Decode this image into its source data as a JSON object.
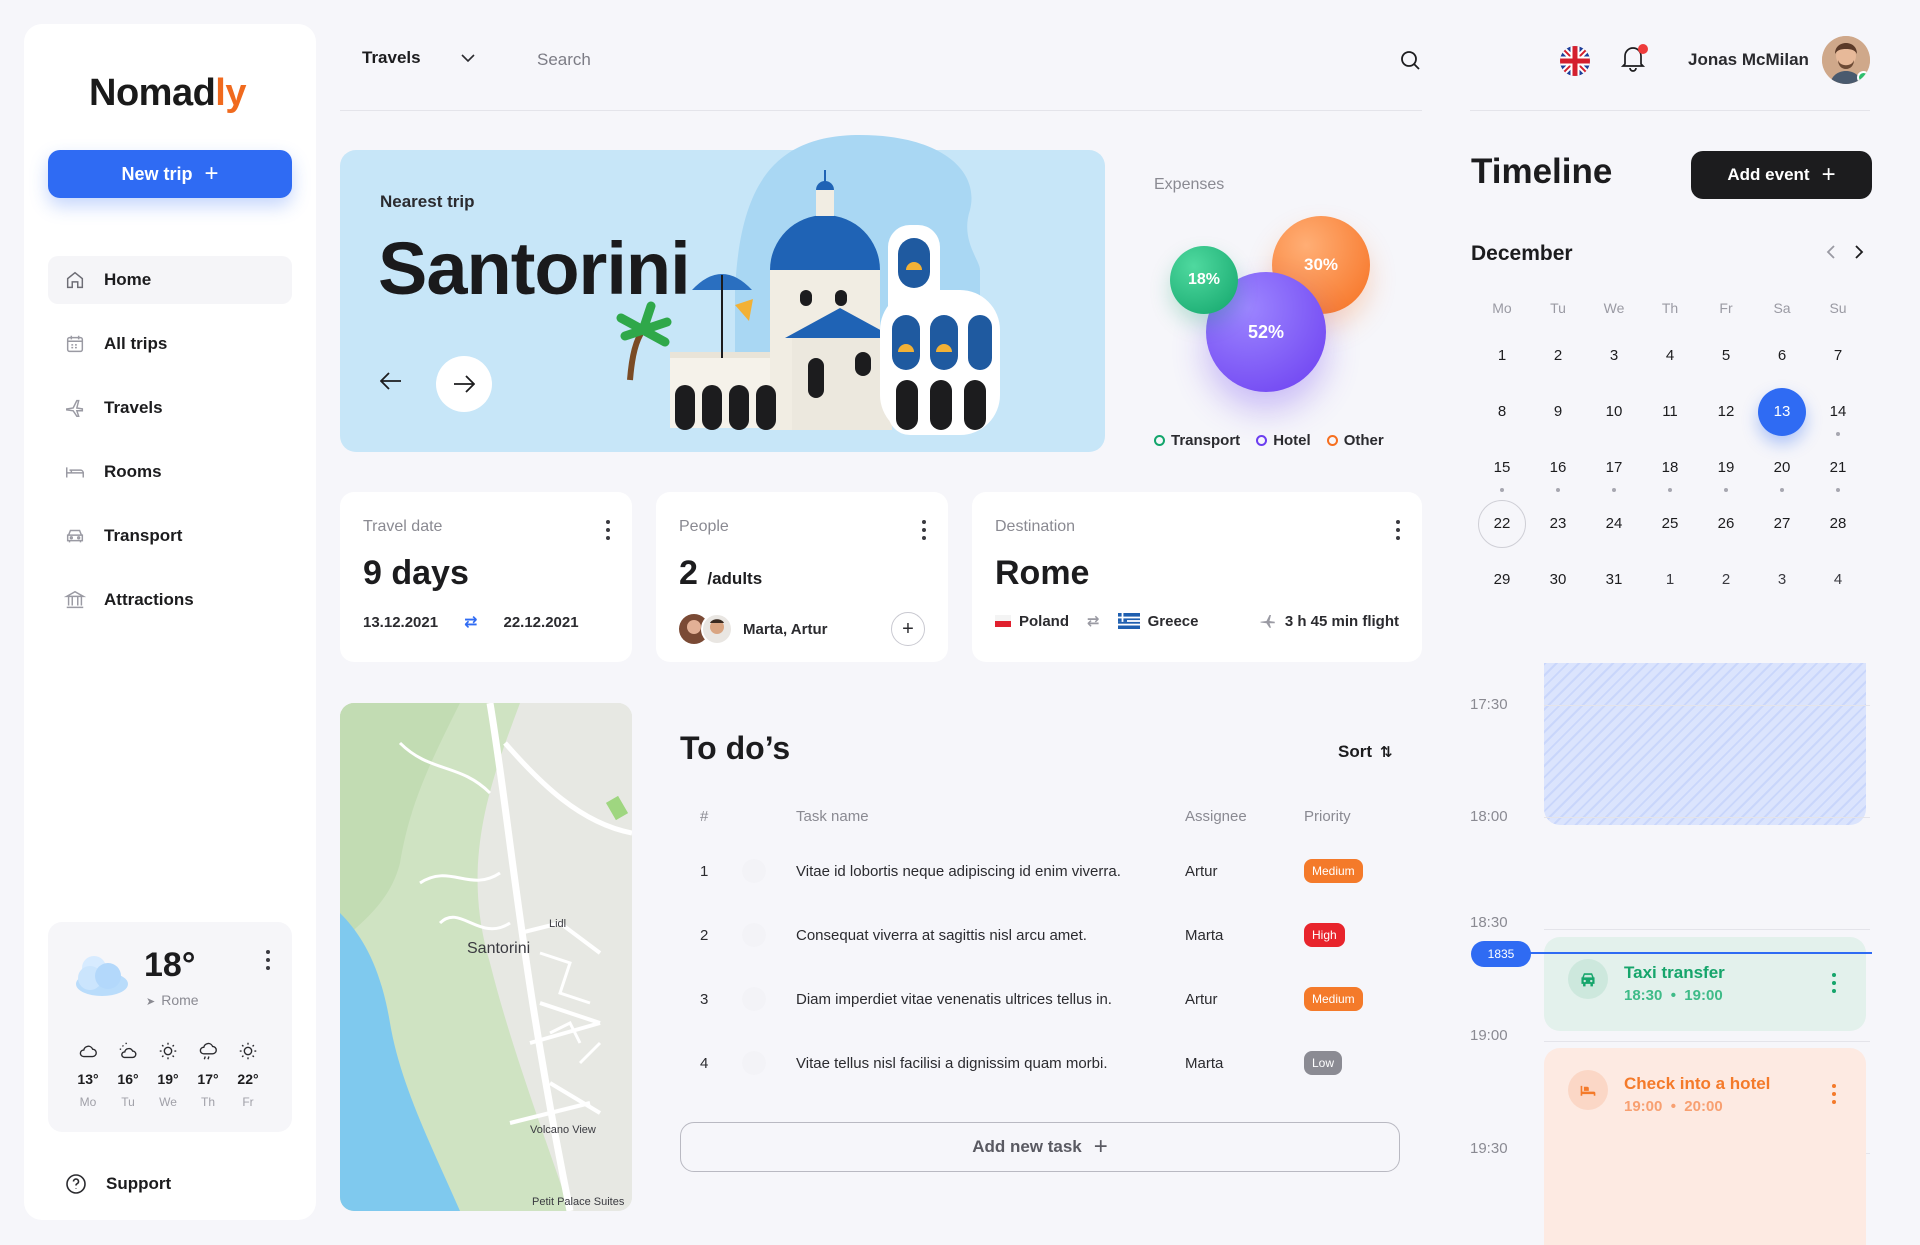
{
  "brand": {
    "name_start": "Nomad",
    "name_accent": "ly",
    "accent_color": "#f06a1e"
  },
  "sidebar": {
    "new_trip_label": "New trip",
    "items": [
      {
        "label": "Home",
        "icon": "home-icon",
        "active": true
      },
      {
        "label": "All trips",
        "icon": "calendar-icon"
      },
      {
        "label": "Travels",
        "icon": "plane-icon"
      },
      {
        "label": "Rooms",
        "icon": "bed-icon"
      },
      {
        "label": "Transport",
        "icon": "car-icon"
      },
      {
        "label": "Attractions",
        "icon": "landmark-icon"
      }
    ],
    "weather": {
      "temp": "18°",
      "city": "Rome",
      "forecast": [
        {
          "temp": "13°",
          "day": "Mo",
          "icon": "cloud-icon"
        },
        {
          "temp": "16°",
          "day": "Tu",
          "icon": "partly-cloudy-icon"
        },
        {
          "temp": "19°",
          "day": "We",
          "icon": "sun-icon"
        },
        {
          "temp": "17°",
          "day": "Th",
          "icon": "rain-icon"
        },
        {
          "temp": "22°",
          "day": "Fr",
          "icon": "sun-icon"
        }
      ]
    },
    "support_label": "Support"
  },
  "header": {
    "select_value": "Travels",
    "search_placeholder": "Search",
    "user_name": "Jonas McMilan"
  },
  "hero": {
    "label": "Nearest trip",
    "title": "Santorini"
  },
  "expenses": {
    "title": "Expenses",
    "slices": [
      {
        "name": "Transport",
        "value": "18%",
        "color": "#12a56b"
      },
      {
        "name": "Hotel",
        "value": "52%",
        "color": "#6b3df0"
      },
      {
        "name": "Other",
        "value": "30%",
        "color": "#f66f1f"
      }
    ]
  },
  "cards": {
    "travel_date": {
      "label": "Travel date",
      "value": "9 days",
      "from": "13.12.2021",
      "to": "22.12.2021"
    },
    "people": {
      "label": "People",
      "value": "2",
      "unit": "/adults",
      "names": "Marta, Artur"
    },
    "destination": {
      "label": "Destination",
      "value": "Rome",
      "from": "Poland",
      "to": "Greece",
      "flight": "3 h 45 min flight"
    }
  },
  "map": {
    "place": "Santorini",
    "poi_1": "Lidl",
    "poi_2": "Volcano View",
    "poi_3": "Petit Palace Suites"
  },
  "todo": {
    "title": "To do’s",
    "sort_label": "Sort",
    "headers": {
      "num": "#",
      "task": "Task name",
      "assignee": "Assignee",
      "priority": "Priority"
    },
    "rows": [
      {
        "num": "1",
        "task": "Vitae id lobortis neque adipiscing id enim viverra.",
        "assignee": "Artur",
        "priority": "Medium",
        "color": "#f47a2a"
      },
      {
        "num": "2",
        "task": "Consequat viverra at sagittis nisl arcu amet.",
        "assignee": "Marta",
        "priority": "High",
        "color": "#e8242c"
      },
      {
        "num": "3",
        "task": "Diam imperdiet vitae venenatis ultrices tellus in.",
        "assignee": "Artur",
        "priority": "Medium",
        "color": "#f47a2a"
      },
      {
        "num": "4",
        "task": "Vitae tellus nisl facilisi a dignissim quam morbi.",
        "assignee": "Marta",
        "priority": "Low",
        "color": "#8b8b93"
      }
    ],
    "add_label": "Add new task"
  },
  "timeline": {
    "title": "Timeline",
    "add_event_label": "Add event",
    "month": "December",
    "weekdays": [
      "Mo",
      "Tu",
      "We",
      "Th",
      "Fr",
      "Sa",
      "Su"
    ],
    "weeks": [
      [
        "1",
        "2",
        "3",
        "4",
        "5",
        "6",
        "7"
      ],
      [
        "8",
        "9",
        "10",
        "11",
        "12",
        "13",
        "14"
      ],
      [
        "15",
        "16",
        "17",
        "18",
        "19",
        "20",
        "21"
      ],
      [
        "22",
        "23",
        "24",
        "25",
        "26",
        "27",
        "28"
      ],
      [
        "29",
        "30",
        "31",
        "1",
        "2",
        "3",
        "4"
      ]
    ],
    "selected_day": "13",
    "today": "22",
    "times": [
      "17:30",
      "18:00",
      "18:30",
      "19:00",
      "19:30"
    ],
    "now": "1835",
    "events": [
      {
        "title": "Taxi transfer",
        "start": "18:30",
        "end": "19:00",
        "icon": "car-icon",
        "color": "#16a56b",
        "bg": "#e3f1ec"
      },
      {
        "title": "Check into a hotel",
        "start": "19:00",
        "end": "20:00",
        "icon": "bed-icon",
        "color": "#f47a2a",
        "bg": "#fdeae2"
      }
    ]
  }
}
